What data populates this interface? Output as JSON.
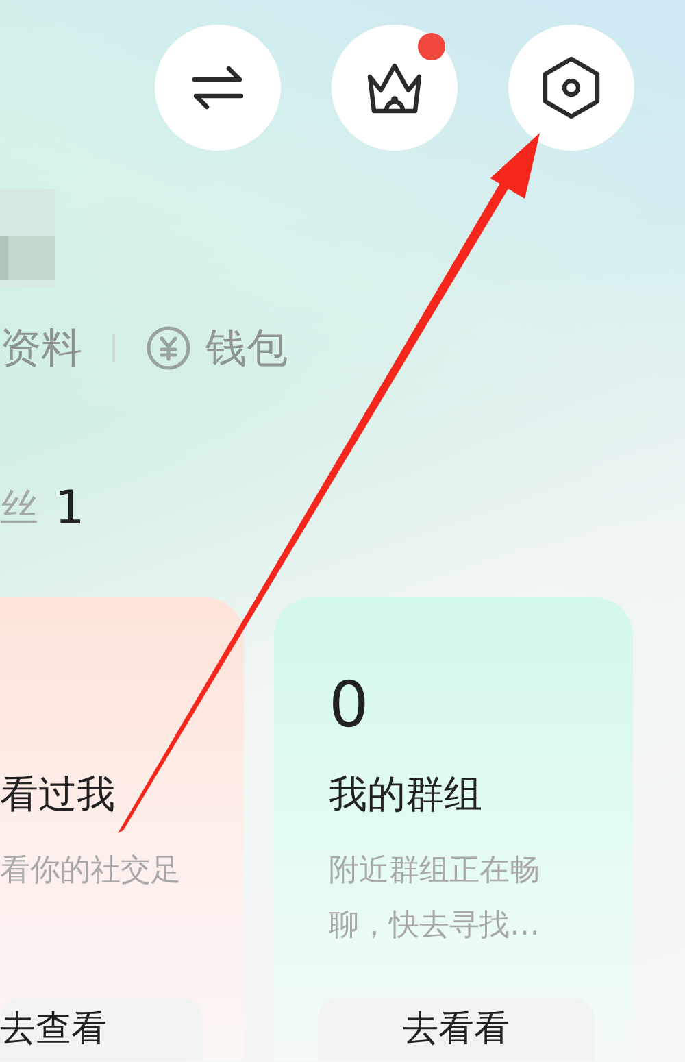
{
  "top_buttons": [
    {
      "kind": "swap",
      "badge": false
    },
    {
      "kind": "crown",
      "badge": true
    },
    {
      "kind": "settings",
      "badge": false
    }
  ],
  "profile_links": [
    {
      "kind": "plain",
      "label": "资料"
    },
    {
      "kind": "wallet",
      "label": "钱包"
    }
  ],
  "followers": {
    "label": "丝",
    "count": "1"
  },
  "cards": [
    {
      "kind": "peach",
      "title": "看过我",
      "description": "看你的社交足",
      "button": "去查看"
    },
    {
      "kind": "mint",
      "count": "0",
      "title": "我的群组",
      "description": "附近群组正在畅聊，快去寻找…",
      "button": "去看看"
    }
  ]
}
